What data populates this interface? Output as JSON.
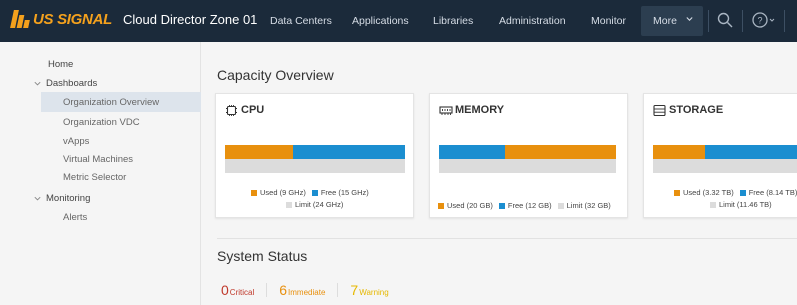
{
  "brand": {
    "logo_text": "US SIGNAL",
    "app_title": "Cloud Director Zone 01"
  },
  "nav": {
    "items": [
      "Data Centers",
      "Applications",
      "Libraries",
      "Administration",
      "Monitor"
    ],
    "more_label": "More",
    "icons": [
      "search-icon",
      "help-icon"
    ]
  },
  "sidebar": {
    "home": "Home",
    "dashboards": {
      "label": "Dashboards",
      "items": [
        "Organization Overview",
        "Organization VDC",
        "vApps",
        "Virtual Machines",
        "Metric Selector"
      ],
      "active_index": 0
    },
    "monitoring": {
      "label": "Monitoring",
      "items": [
        "Alerts"
      ]
    }
  },
  "capacity": {
    "title": "Capacity Overview",
    "cards": [
      {
        "title": "CPU",
        "icon": "cpu-icon",
        "used_fraction": 0.375,
        "legend": {
          "used": "Used (9 GHz)",
          "free": "Free (15 GHz)",
          "limit": "Limit (24 GHz)"
        }
      },
      {
        "title": "MEMORY",
        "icon": "memory-icon",
        "free_fraction": 0.375,
        "legend": {
          "used": "Used (20 GB)",
          "free": "Free (12 GB)",
          "limit": "Limit (32 GB)"
        }
      },
      {
        "title": "STORAGE",
        "icon": "storage-icon",
        "used_fraction": 0.29,
        "legend": {
          "used": "Used (3.32 TB)",
          "free": "Free (8.14 TB)",
          "limit": "Limit (11.46 TB)"
        }
      }
    ],
    "colors": {
      "used": "#e8900e",
      "free": "#1b8ed0",
      "limit": "#dcdcdc"
    }
  },
  "system_status": {
    "title": "System Status",
    "items": [
      {
        "count": "0",
        "label": "Critical",
        "color": "#c0392b"
      },
      {
        "count": "6",
        "label": "Immediate",
        "color": "#e8900e"
      },
      {
        "count": "7",
        "label": "Warning",
        "color": "#e6b800"
      }
    ]
  }
}
